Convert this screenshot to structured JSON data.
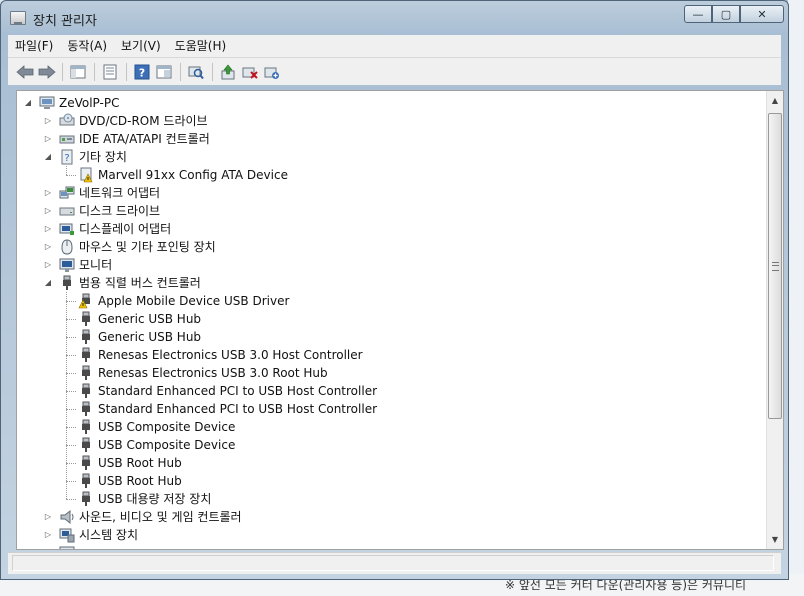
{
  "window": {
    "title": "장치 관리자",
    "min_glyph": "—",
    "max_glyph": "▢",
    "close_glyph": "✕"
  },
  "menu": [
    "파일(F)",
    "동작(A)",
    "보기(V)",
    "도움말(H)"
  ],
  "toolbar_icons": [
    "back-arrow-icon",
    "forward-arrow-icon",
    "show-hide-tree-icon",
    "properties-icon",
    "help-icon",
    "view-icon",
    "scan-hardware-icon",
    "update-driver-icon",
    "disable-device-icon",
    "uninstall-device-icon"
  ],
  "tree": [
    {
      "label": "ZeVolP-PC",
      "level": 0,
      "expander": "expanded",
      "icon": "computer-icon"
    },
    {
      "label": "DVD/CD-ROM 드라이브",
      "level": 1,
      "expander": "collapsed",
      "icon": "dvd-drive-icon"
    },
    {
      "label": "IDE ATA/ATAPI 컨트롤러",
      "level": 1,
      "expander": "collapsed",
      "icon": "ide-controller-icon"
    },
    {
      "label": "기타 장치",
      "level": 1,
      "expander": "expanded",
      "icon": "unknown-device-icon"
    },
    {
      "label": "Marvell 91xx Config ATA Device",
      "level": 2,
      "expander": "none",
      "icon": "warning-device-icon"
    },
    {
      "label": "네트워크 어댑터",
      "level": 1,
      "expander": "collapsed",
      "icon": "network-adapter-icon"
    },
    {
      "label": "디스크 드라이브",
      "level": 1,
      "expander": "collapsed",
      "icon": "disk-drive-icon"
    },
    {
      "label": "디스플레이 어댑터",
      "level": 1,
      "expander": "collapsed",
      "icon": "display-adapter-icon"
    },
    {
      "label": "마우스 및 기타 포인팅 장치",
      "level": 1,
      "expander": "collapsed",
      "icon": "mouse-icon"
    },
    {
      "label": "모니터",
      "level": 1,
      "expander": "collapsed",
      "icon": "monitor-icon"
    },
    {
      "label": "범용 직렬 버스 컨트롤러",
      "level": 1,
      "expander": "expanded",
      "icon": "usb-plug-icon"
    },
    {
      "label": "Apple Mobile Device USB Driver",
      "level": 2,
      "expander": "none",
      "icon": "usb-warning-icon"
    },
    {
      "label": "Generic USB Hub",
      "level": 2,
      "expander": "none",
      "icon": "usb-plug-icon"
    },
    {
      "label": "Generic USB Hub",
      "level": 2,
      "expander": "none",
      "icon": "usb-plug-icon"
    },
    {
      "label": "Renesas Electronics USB 3.0 Host Controller",
      "level": 2,
      "expander": "none",
      "icon": "usb-plug-icon"
    },
    {
      "label": "Renesas Electronics USB 3.0 Root Hub",
      "level": 2,
      "expander": "none",
      "icon": "usb-plug-icon"
    },
    {
      "label": "Standard Enhanced PCI to USB Host Controller",
      "level": 2,
      "expander": "none",
      "icon": "usb-plug-icon"
    },
    {
      "label": "Standard Enhanced PCI to USB Host Controller",
      "level": 2,
      "expander": "none",
      "icon": "usb-plug-icon"
    },
    {
      "label": "USB Composite Device",
      "level": 2,
      "expander": "none",
      "icon": "usb-plug-icon"
    },
    {
      "label": "USB Composite Device",
      "level": 2,
      "expander": "none",
      "icon": "usb-plug-icon"
    },
    {
      "label": "USB Root Hub",
      "level": 2,
      "expander": "none",
      "icon": "usb-plug-icon"
    },
    {
      "label": "USB Root Hub",
      "level": 2,
      "expander": "none",
      "icon": "usb-plug-icon"
    },
    {
      "label": "USB 대용량 저장 장치",
      "level": 2,
      "expander": "none",
      "icon": "usb-plug-icon"
    },
    {
      "label": "사운드, 비디오 및 게임 컨트롤러",
      "level": 1,
      "expander": "collapsed",
      "icon": "speaker-icon"
    },
    {
      "label": "시스템 장치",
      "level": 1,
      "expander": "collapsed",
      "icon": "system-device-icon"
    },
    {
      "label": "",
      "level": 1,
      "expander": "collapsed",
      "icon": "computer-icon"
    }
  ],
  "background_text": "※ 앞선 모든 커터 다운(관리자용 등)은  커뮤니티",
  "colors": {
    "usb": "#4a4a4a",
    "warning": "#f2c200",
    "link": "#2a6cc0"
  }
}
